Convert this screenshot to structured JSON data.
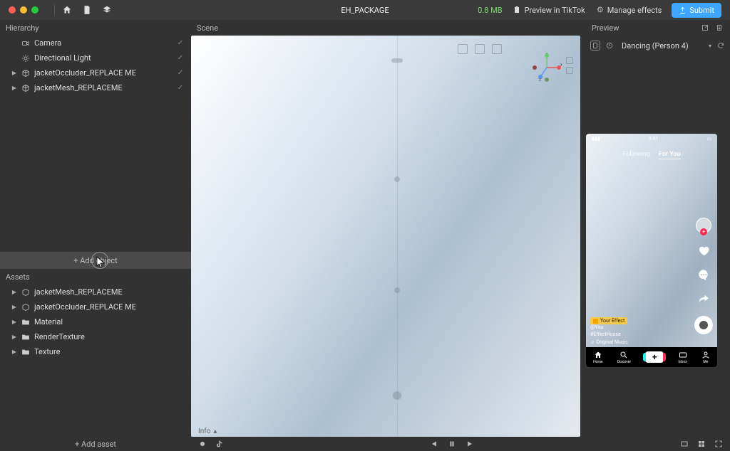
{
  "topbar": {
    "title": "EH_PACKAGE",
    "filesize": "0.8 MB",
    "tabs": {
      "preview": "Preview in TikTok",
      "manage": "Manage effects",
      "submit": "Submit"
    }
  },
  "hierarchy": {
    "title": "Hierarchy",
    "add_object": "+ Add object",
    "items": [
      {
        "label": "Camera",
        "hasChildren": false,
        "checked": true
      },
      {
        "label": "Directional Light",
        "hasChildren": false,
        "checked": true
      },
      {
        "label": "jacketOccluder_REPLACE ME",
        "hasChildren": true,
        "checked": true
      },
      {
        "label": "jacketMesh_REPLACEME",
        "hasChildren": true,
        "checked": true
      }
    ]
  },
  "assets": {
    "title": "Assets",
    "add_asset": "+ Add asset",
    "items": [
      {
        "label": "jacketMesh_REPLACEME",
        "icon": "cube",
        "hasChildren": true
      },
      {
        "label": "jacketOccluder_REPLACE ME",
        "icon": "cube",
        "hasChildren": true
      },
      {
        "label": "Material",
        "icon": "folder",
        "hasChildren": true
      },
      {
        "label": "RenderTexture",
        "icon": "folder",
        "hasChildren": true
      },
      {
        "label": "Texture",
        "icon": "folder",
        "hasChildren": true
      }
    ]
  },
  "scene": {
    "title": "Scene",
    "info": "Info",
    "gizmo": {
      "x": "X",
      "y": "Y",
      "z": "Z"
    }
  },
  "preview": {
    "title": "Preview",
    "selector": "Dancing (Person 4)",
    "phone": {
      "time": "9:41",
      "tabs": {
        "following": "Following",
        "foryou": "For You"
      },
      "badge": "Your Effect",
      "user": "@You",
      "hashtag": "#EffectHouse",
      "sound": "Original Music",
      "nav": {
        "home": "Home",
        "discover": "Discover",
        "inbox": "Inbox",
        "me": "Me"
      }
    }
  }
}
